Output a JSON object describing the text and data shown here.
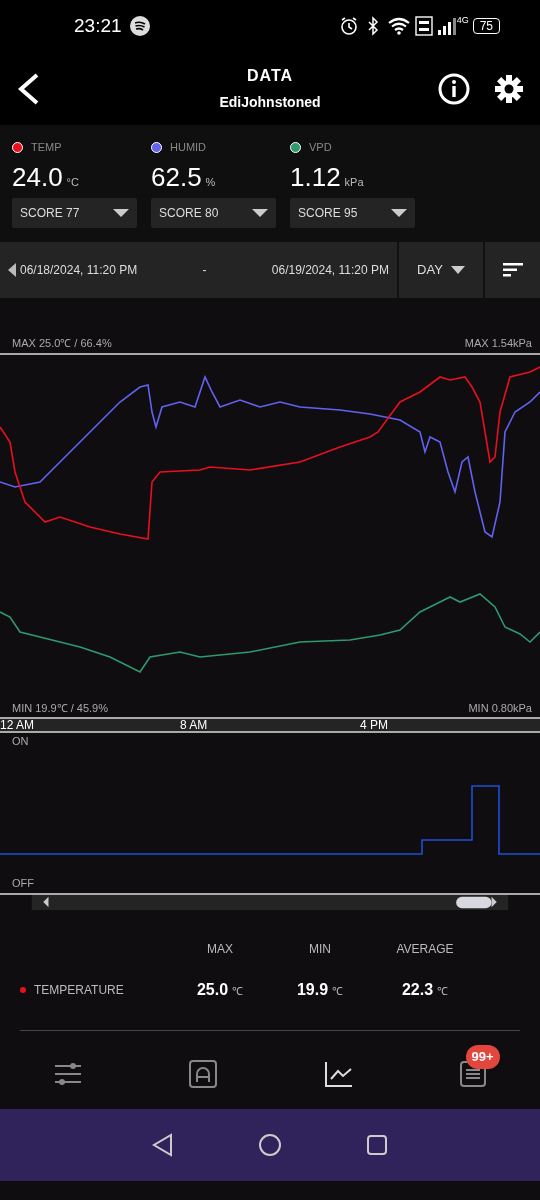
{
  "status_bar": {
    "time": "23:21",
    "battery": "75",
    "network": "4G"
  },
  "header": {
    "title": "DATA",
    "subtitle": "EdiJohnstoned"
  },
  "sensors": [
    {
      "label": "TEMP",
      "color": "#e8101e",
      "value": "24.0",
      "unit": "°C",
      "score": "SCORE 77"
    },
    {
      "label": "HUMID",
      "color": "#6262f0",
      "value": "62.5",
      "unit": "%",
      "score": "SCORE 80"
    },
    {
      "label": "VPD",
      "color": "#2e9a6e",
      "value": "1.12",
      "unit": "kPa",
      "score": "SCORE 95"
    }
  ],
  "date_range": {
    "from": "06/18/2024, 11:20 PM",
    "separator": "-",
    "to": "06/19/2024, 11:20 PM",
    "period": "DAY"
  },
  "chart": {
    "max_left": "MAX 25.0℃ / 66.4%",
    "max_right": "MAX 1.54kPa",
    "min_left": "MIN 19.9℃ / 45.9%",
    "min_right": "MIN 0.80kPa",
    "x_labels": [
      "12 AM",
      "8 AM",
      "4 PM"
    ]
  },
  "switch_chart": {
    "on_label": "ON",
    "off_label": "OFF"
  },
  "stats": {
    "columns": [
      "MAX",
      "MIN",
      "AVERAGE"
    ],
    "rows": [
      {
        "label": "TEMPERATURE",
        "color": "#e8101e",
        "max": "25.0",
        "min": "19.9",
        "average": "22.3",
        "unit": "℃"
      }
    ]
  },
  "bottom_nav": [
    {
      "kind": "sliders",
      "selected": false
    },
    {
      "kind": "automation",
      "selected": false
    },
    {
      "kind": "chart",
      "selected": true
    },
    {
      "kind": "log",
      "selected": false,
      "badge": "99+"
    }
  ]
}
